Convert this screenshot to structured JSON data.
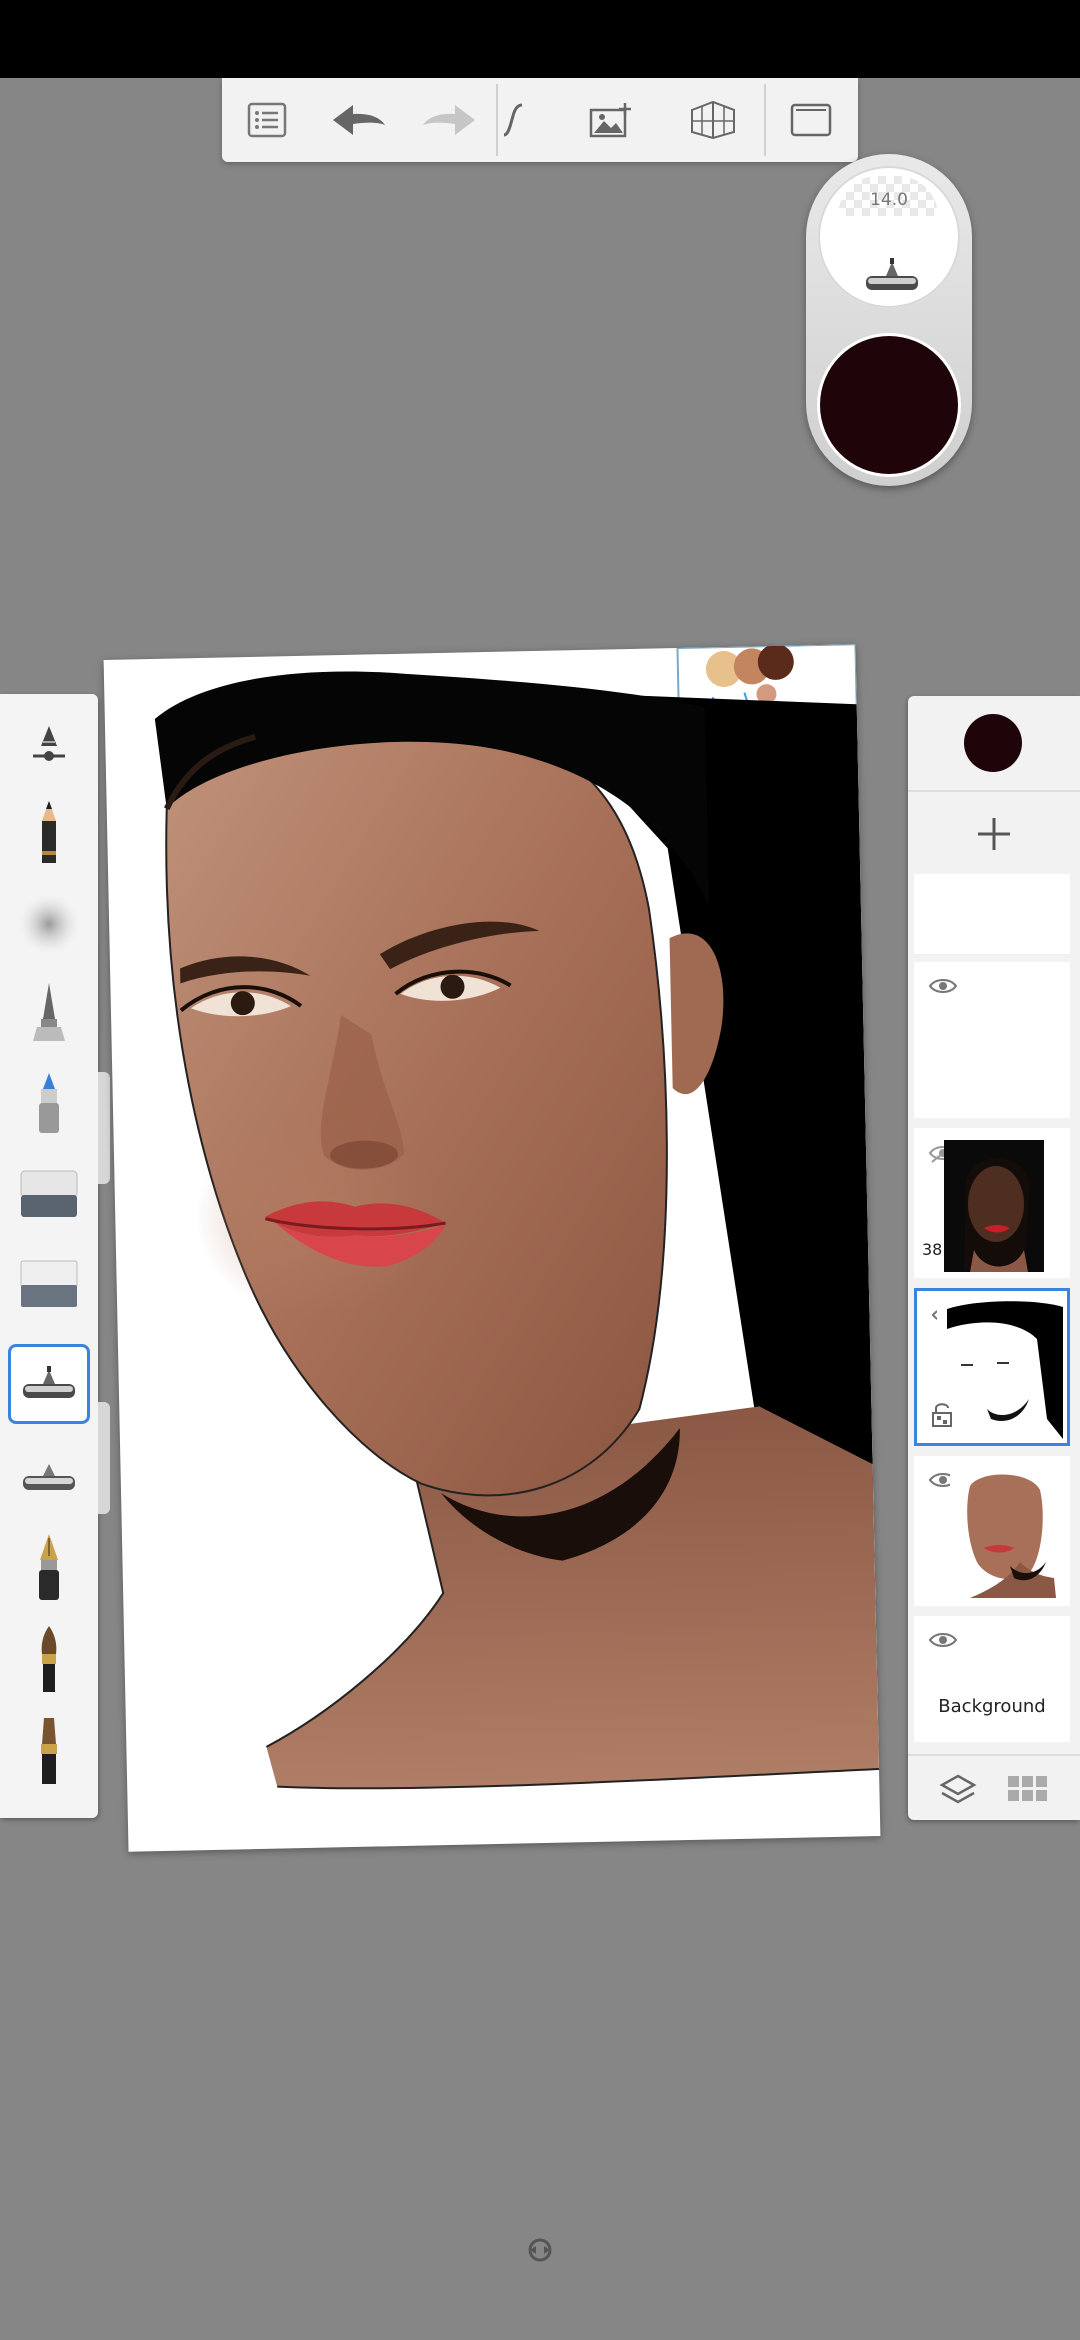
{
  "brush_puck": {
    "size_label": "14.0",
    "color": "#1f0409"
  },
  "toolbar": {
    "items": [
      "list-icon",
      "undo-icon",
      "redo-icon",
      "stroke-curve-icon",
      "add-image-icon",
      "perspective-grid-icon",
      "fullscreen-icon"
    ]
  },
  "brushes": [
    "brush-settings-icon",
    "pencil-icon",
    "airbrush-spray-icon",
    "ink-pen-icon",
    "marker-icon",
    "eraser-icon",
    "soft-eraser-icon",
    "airbrush-icon",
    "airbrush-alt-icon",
    "fountain-pen-icon",
    "paintbrush-icon",
    "flat-brush-icon"
  ],
  "selected_brush_index": 7,
  "layers": {
    "current_color": "#1f0409",
    "items": [
      {
        "name": "",
        "visible": true
      },
      {
        "name": "",
        "visible": true
      },
      {
        "name": "",
        "opacity_label": "38",
        "visible": false
      },
      {
        "name": "",
        "visible": true,
        "locked": true,
        "selected": true
      },
      {
        "name": "",
        "visible": true
      },
      {
        "name": "Background",
        "visible": true
      }
    ]
  }
}
